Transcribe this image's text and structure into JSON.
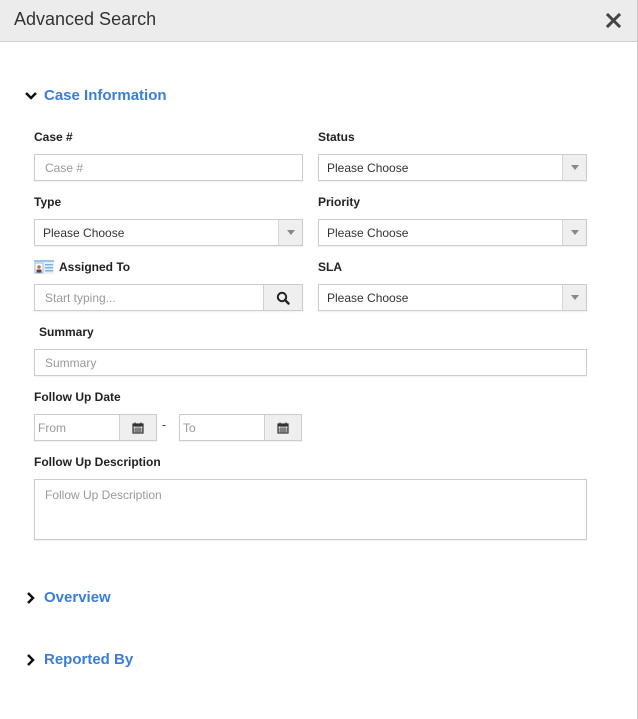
{
  "header": {
    "title": "Advanced Search",
    "close_icon": "close-icon"
  },
  "sections": {
    "case_information": {
      "title": "Case Information",
      "expanded": true,
      "icon": "chevron-down-icon"
    },
    "overview": {
      "title": "Overview",
      "expanded": false,
      "icon": "chevron-right-icon"
    },
    "reported_by": {
      "title": "Reported By",
      "expanded": false,
      "icon": "chevron-right-icon"
    }
  },
  "fields": {
    "case_number": {
      "label": "Case #",
      "placeholder": "Case #",
      "value": ""
    },
    "status": {
      "label": "Status",
      "value": "Please Choose"
    },
    "type": {
      "label": "Type",
      "value": "Please Choose"
    },
    "priority": {
      "label": "Priority",
      "value": "Please Choose"
    },
    "assigned_to": {
      "label": "Assigned To",
      "placeholder": "Start typing...",
      "value": "",
      "icon": "contact-card-icon",
      "button_icon": "search-icon"
    },
    "sla": {
      "label": "SLA",
      "value": "Please Choose"
    },
    "summary": {
      "label": "Summary",
      "placeholder": "Summary",
      "value": ""
    },
    "follow_up_date": {
      "label": "Follow Up Date",
      "from_placeholder": "From",
      "to_placeholder": "To",
      "separator": "-",
      "button_icon": "calendar-icon"
    },
    "follow_up_description": {
      "label": "Follow Up Description",
      "placeholder": "Follow Up Description",
      "value": ""
    }
  },
  "colors": {
    "accent": "#3b7ddd",
    "header_bg": "#ececec"
  }
}
